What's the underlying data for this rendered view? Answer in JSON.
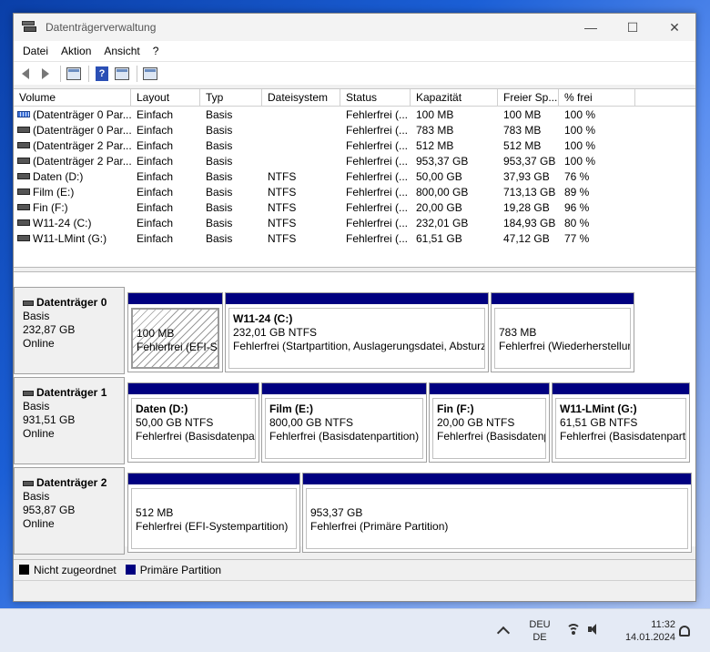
{
  "window": {
    "title": "Datenträgerverwaltung",
    "controls": {
      "minimize": "—",
      "maximize": "☐",
      "close": "✕"
    }
  },
  "menu": [
    "Datei",
    "Aktion",
    "Ansicht",
    "?"
  ],
  "toolbar": [
    "back-icon",
    "forward-icon",
    "properties-icon",
    "help-icon",
    "console-icon",
    "list-icon"
  ],
  "columns": [
    "Volume",
    "Layout",
    "Typ",
    "Dateisystem",
    "Status",
    "Kapazität",
    "Freier Sp...",
    "% frei",
    ""
  ],
  "volumes": [
    {
      "name": "(Datenträger 0 Par...",
      "layout": "Einfach",
      "type": "Basis",
      "fs": "",
      "status": "Fehlerfrei (...",
      "capacity": "100 MB",
      "free": "100 MB",
      "pct": "100 %",
      "icon": "striped"
    },
    {
      "name": "(Datenträger 0 Par...",
      "layout": "Einfach",
      "type": "Basis",
      "fs": "",
      "status": "Fehlerfrei (...",
      "capacity": "783 MB",
      "free": "783 MB",
      "pct": "100 %",
      "icon": "plain"
    },
    {
      "name": "(Datenträger 2 Par...",
      "layout": "Einfach",
      "type": "Basis",
      "fs": "",
      "status": "Fehlerfrei (...",
      "capacity": "512 MB",
      "free": "512 MB",
      "pct": "100 %",
      "icon": "plain"
    },
    {
      "name": "(Datenträger 2 Par...",
      "layout": "Einfach",
      "type": "Basis",
      "fs": "",
      "status": "Fehlerfrei (...",
      "capacity": "953,37 GB",
      "free": "953,37 GB",
      "pct": "100 %",
      "icon": "plain"
    },
    {
      "name": "Daten (D:)",
      "layout": "Einfach",
      "type": "Basis",
      "fs": "NTFS",
      "status": "Fehlerfrei (...",
      "capacity": "50,00 GB",
      "free": "37,93 GB",
      "pct": "76 %",
      "icon": "plain"
    },
    {
      "name": "Film (E:)",
      "layout": "Einfach",
      "type": "Basis",
      "fs": "NTFS",
      "status": "Fehlerfrei (...",
      "capacity": "800,00 GB",
      "free": "713,13 GB",
      "pct": "89 %",
      "icon": "plain"
    },
    {
      "name": "Fin (F:)",
      "layout": "Einfach",
      "type": "Basis",
      "fs": "NTFS",
      "status": "Fehlerfrei (...",
      "capacity": "20,00 GB",
      "free": "19,28 GB",
      "pct": "96 %",
      "icon": "plain"
    },
    {
      "name": "W11-24 (C:)",
      "layout": "Einfach",
      "type": "Basis",
      "fs": "NTFS",
      "status": "Fehlerfrei (...",
      "capacity": "232,01 GB",
      "free": "184,93 GB",
      "pct": "80 %",
      "icon": "plain"
    },
    {
      "name": "W11-LMint (G:)",
      "layout": "Einfach",
      "type": "Basis",
      "fs": "NTFS",
      "status": "Fehlerfrei (...",
      "capacity": "61,51 GB",
      "free": "47,12 GB",
      "pct": "77 %",
      "icon": "plain"
    }
  ],
  "disks": [
    {
      "name": "Datenträger 0",
      "type": "Basis",
      "size": "232,87 GB",
      "state": "Online",
      "partitions": [
        {
          "label": "",
          "line1": "100 MB",
          "line2": "Fehlerfrei (EFI-Sys",
          "hatched": true
        },
        {
          "label": "W11-24  (C:)",
          "line1": "232,01 GB NTFS",
          "line2": "Fehlerfrei (Startpartition, Auslagerungsdatei, Absturz",
          "hatched": false
        },
        {
          "label": "",
          "line1": "783 MB",
          "line2": "Fehlerfrei (Wiederherstellur",
          "hatched": false
        }
      ]
    },
    {
      "name": "Datenträger 1",
      "type": "Basis",
      "size": "931,51 GB",
      "state": "Online",
      "partitions": [
        {
          "label": "Daten  (D:)",
          "line1": "50,00 GB NTFS",
          "line2": "Fehlerfrei (Basisdatenpart",
          "hatched": false
        },
        {
          "label": "Film  (E:)",
          "line1": "800,00 GB NTFS",
          "line2": "Fehlerfrei (Basisdatenpartition)",
          "hatched": false
        },
        {
          "label": "Fin  (F:)",
          "line1": "20,00 GB NTFS",
          "line2": "Fehlerfrei (Basisdatenp",
          "hatched": false
        },
        {
          "label": "W11-LMint  (G:)",
          "line1": "61,51 GB NTFS",
          "line2": "Fehlerfrei (Basisdatenparti",
          "hatched": false
        }
      ]
    },
    {
      "name": "Datenträger 2",
      "type": "Basis",
      "size": "953,87 GB",
      "state": "Online",
      "partitions": [
        {
          "label": "",
          "line1": "512 MB",
          "line2": "Fehlerfrei (EFI-Systempartition)",
          "hatched": false
        },
        {
          "label": "",
          "line1": "953,37 GB",
          "line2": "Fehlerfrei (Primäre Partition)",
          "hatched": false
        }
      ]
    }
  ],
  "legend": [
    {
      "label": "Nicht zugeordnet",
      "color": "#000000"
    },
    {
      "label": "Primäre Partition",
      "color": "#000080"
    }
  ],
  "taskbar": {
    "lang_line1": "DEU",
    "lang_line2": "DE",
    "time": "11:32",
    "date": "14.01.2024"
  }
}
